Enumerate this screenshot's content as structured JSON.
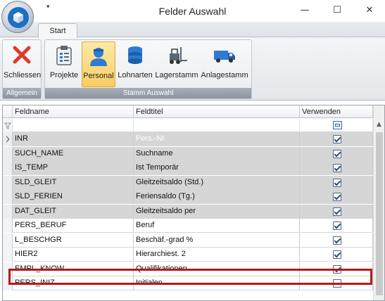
{
  "window": {
    "title": "Felder Auswahl",
    "quick_access_arrow": "▾",
    "minimize": "—",
    "maximize": "☐",
    "close": "✕"
  },
  "tabs": [
    {
      "label": "Start"
    }
  ],
  "ribbon": {
    "groups": [
      {
        "label": "Allgemein",
        "buttons": [
          {
            "label": "Schliessen",
            "icon": "close-x-icon"
          }
        ]
      },
      {
        "label": "Stamm Auswahl",
        "buttons": [
          {
            "label": "Projekte",
            "icon": "clipboard-icon"
          },
          {
            "label": "Personal",
            "icon": "person-icon",
            "active": true
          },
          {
            "label": "Lohnarten",
            "icon": "database-icon"
          },
          {
            "label": "Lagerstamm",
            "icon": "forklift-icon"
          },
          {
            "label": "Anlagestamm",
            "icon": "van-icon"
          }
        ]
      }
    ]
  },
  "grid": {
    "columns": [
      "Feldname",
      "Feldtitel",
      "Verwenden"
    ],
    "rows": [
      {
        "feldname": "INR",
        "feldtitel": "Pers.-Nr.",
        "verwenden": true,
        "selected": true,
        "current": true
      },
      {
        "feldname": "SUCH_NAME",
        "feldtitel": "Suchname",
        "verwenden": true,
        "selected": true
      },
      {
        "feldname": "IS_TEMP",
        "feldtitel": "Ist Temporär",
        "verwenden": true,
        "selected": true
      },
      {
        "feldname": "SLD_GLEIT",
        "feldtitel": "Gleitzeitsaldo (Std.)",
        "verwenden": true,
        "selected": true
      },
      {
        "feldname": "SLD_FERIEN",
        "feldtitel": "Feriensaldo (Tg.)",
        "verwenden": true,
        "selected": true
      },
      {
        "feldname": "DAT_GLEIT",
        "feldtitel": "Gleitzeitsaldo per",
        "verwenden": true,
        "selected": true
      },
      {
        "feldname": "PERS_BERUF",
        "feldtitel": "Beruf",
        "verwenden": true,
        "selected": false
      },
      {
        "feldname": "L_BESCHGR",
        "feldtitel": "Beschäf.-grad %",
        "verwenden": true,
        "selected": false
      },
      {
        "feldname": "HIER2",
        "feldtitel": "Hierarchiest. 2",
        "verwenden": true,
        "selected": false
      },
      {
        "feldname": "EMPL_KNOW",
        "feldtitel": "Qualifikationen",
        "verwenden": true,
        "selected": false,
        "highlighted": true
      },
      {
        "feldname": "PERS_INIZ",
        "feldtitel": "Initialen",
        "verwenden": false,
        "selected": false
      }
    ]
  },
  "colors": {
    "accent_active": "#f9cf62",
    "selected_row": "#d6d6d6",
    "highlight_frame": "#b01c1c",
    "group_label_bg": "#8d949d"
  }
}
